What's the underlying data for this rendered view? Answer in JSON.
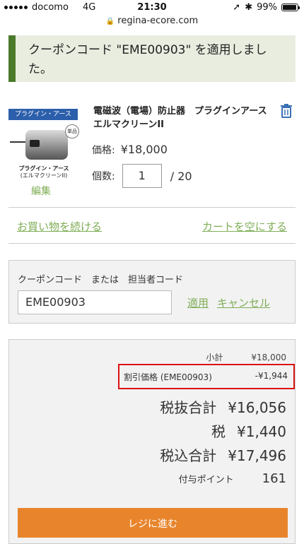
{
  "status": {
    "carrier": "docomo",
    "network": "4G",
    "time": "21:30",
    "battery": "99%",
    "battery_level": 0.99
  },
  "browser": {
    "url": "regina-ecore.com"
  },
  "notice": {
    "message": "クーポンコード \"EME00903\" を適用しました。"
  },
  "product": {
    "brand_banner": "プラグイン・アース",
    "badge": "単品",
    "thumb_caption_1": "プラグイン・アース",
    "thumb_caption_2": "(エルマクリーンII)",
    "edit_label": "編集",
    "name": "電磁波（電場）防止器　プラグインアース　エルマクリーンII",
    "price_label": "価格:",
    "price": "¥18,000",
    "qty_label": "個数:",
    "qty_value": "1",
    "qty_max": "/ 20"
  },
  "links": {
    "continue": "お買い物を続ける",
    "empty_cart": "カートを空にする"
  },
  "coupon": {
    "label": "クーポンコード　または　担当者コード",
    "value": "EME00903",
    "apply": "適用",
    "cancel": "キャンセル"
  },
  "summary": {
    "subtotal_label": "小計",
    "subtotal": "¥18,000",
    "discount_label": "割引価格 (EME00903)",
    "discount": "-¥1,944",
    "excl_label": "税抜合計",
    "excl": "¥16,056",
    "tax_label": "税",
    "tax": "¥1,440",
    "incl_label": "税込合計",
    "incl": "¥17,496",
    "points_label": "付与ポイント",
    "points": "161"
  },
  "checkout": {
    "label": "レジに進む"
  },
  "colors": {
    "accent_green": "#7fae57",
    "notice_bar": "#4a7a2a",
    "checkout": "#e8852c",
    "highlight": "#dd1111",
    "trash": "#3a6fb5"
  }
}
